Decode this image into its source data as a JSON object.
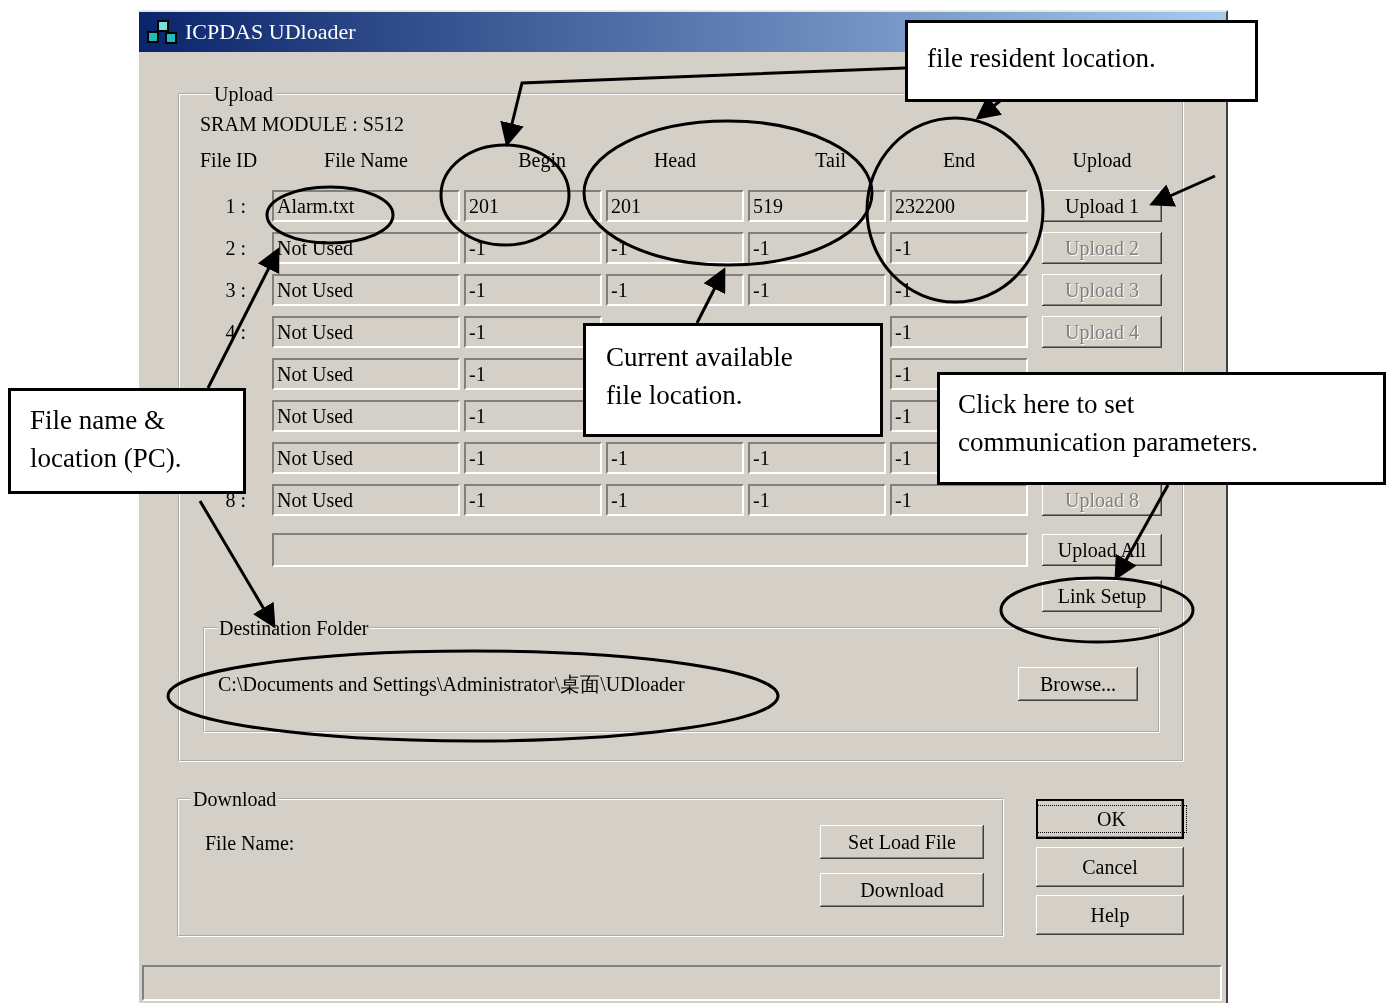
{
  "window": {
    "title": "ICPDAS UDloader"
  },
  "upload": {
    "legend": "Upload",
    "module": "SRAM MODULE : S512",
    "columns": [
      "File ID",
      "File Name",
      "Begin",
      "Head",
      "Tail",
      "End",
      "Upload"
    ],
    "rows": [
      {
        "id": "1 :",
        "file_name": "Alarm.txt",
        "begin": "201",
        "head": "201",
        "tail": "519",
        "end": "232200",
        "button": {
          "label": "Upload 1",
          "disabled": false
        }
      },
      {
        "id": "2 :",
        "file_name": "Not Used",
        "begin": "-1",
        "head": "-1",
        "tail": "-1",
        "end": "-1",
        "button": {
          "label": "Upload 2",
          "disabled": true
        }
      },
      {
        "id": "3 :",
        "file_name": "Not Used",
        "begin": "-1",
        "head": "-1",
        "tail": "-1",
        "end": "-1",
        "button": {
          "label": "Upload 3",
          "disabled": true
        }
      },
      {
        "id": "4 :",
        "file_name": "Not Used",
        "begin": "-1",
        "end": "-1",
        "button": {
          "label": "Upload 4",
          "disabled": true
        }
      },
      {
        "file_name": "Not Used",
        "begin": "-1",
        "end": "-1"
      },
      {
        "file_name": "Not Used",
        "begin": "-1",
        "end": "-1"
      },
      {
        "file_name": "Not Used",
        "begin": "-1",
        "head": "-1",
        "tail": "-1",
        "end": "-1"
      },
      {
        "id": "8 :",
        "file_name": "Not Used",
        "begin": "-1",
        "head": "-1",
        "tail": "-1",
        "end": "-1",
        "button": {
          "label": "Upload 8",
          "disabled": true
        }
      }
    ],
    "upload_all": "Upload All",
    "link_setup": "Link Setup",
    "destination": {
      "legend": "Destination Folder",
      "path": "C:\\Documents and Settings\\Administrator\\桌面\\UDloader",
      "browse": "Browse..."
    }
  },
  "download": {
    "legend": "Download",
    "file_name_label": "File Name:",
    "buttons": [
      "Set Load File",
      "Download"
    ]
  },
  "dialog_buttons": [
    {
      "label": "OK",
      "default": true
    },
    {
      "label": "Cancel",
      "default": false
    },
    {
      "label": "Help",
      "default": false
    }
  ],
  "annotations": [
    {
      "text": "file resident location."
    },
    {
      "text": "Current available file location."
    },
    {
      "text": "File name & location (PC)."
    },
    {
      "text": "Click here to set communication parameters."
    }
  ]
}
